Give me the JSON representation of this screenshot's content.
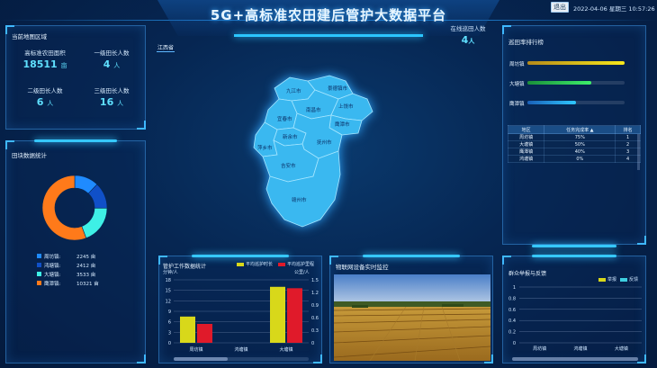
{
  "header": {
    "title": "5G+高标准农田建后管护大数据平台",
    "exit_label": "退出",
    "datetime": "2022-04-06 星期三 10:57:26"
  },
  "online": {
    "label": "在线巡田人数",
    "value": "4",
    "unit": "人"
  },
  "region_panel": {
    "title": "当前地图区域",
    "stats": [
      {
        "label": "高标准农田面积",
        "value": "18511",
        "unit": "亩"
      },
      {
        "label": "一级田长人数",
        "value": "4",
        "unit": "人"
      },
      {
        "label": "二级田长人数",
        "value": "6",
        "unit": "人"
      },
      {
        "label": "三级田长人数",
        "value": "16",
        "unit": "人"
      }
    ]
  },
  "plot_panel": {
    "title": "田块数据统计",
    "items": [
      {
        "name": "周坊镇:",
        "value": "2245 亩",
        "raw": 2245,
        "color": "#1f8bff"
      },
      {
        "name": "鸿塘镇:",
        "value": "2412 亩",
        "raw": 2412,
        "color": "#1050c8"
      },
      {
        "name": "大塘镇:",
        "value": "3533 亩",
        "raw": 3533,
        "color": "#3ef0e6"
      },
      {
        "name": "鹰潭镇:",
        "value": "10321 亩",
        "raw": 10321,
        "color": "#ff7a1a"
      }
    ]
  },
  "map": {
    "breadcrumb": "江西省",
    "cities": [
      "九江市",
      "景德镇市",
      "南昌市",
      "上饶市",
      "宜春市",
      "鹰潭市",
      "新余市",
      "萍乡市",
      "抚州市",
      "吉安市",
      "赣州市"
    ]
  },
  "patrol_rank": {
    "title": "巡田率排行榜",
    "bars": [
      {
        "name": "周坊镇",
        "pct": 1.0,
        "color_from": "#b58a1a",
        "color_to": "#f8e81a"
      },
      {
        "name": "大塘镇",
        "pct": 0.66,
        "color_from": "#1a8f3a",
        "color_to": "#3ef06a"
      },
      {
        "name": "鹰潭镇",
        "pct": 0.5,
        "color_from": "#1a5fb8",
        "color_to": "#2ec8ff"
      }
    ],
    "table": {
      "headers": [
        "地区",
        "任务完成率 ▲",
        "排名"
      ],
      "rows": [
        [
          "周坊镇",
          "75%",
          "1"
        ],
        [
          "大塘镇",
          "50%",
          "2"
        ],
        [
          "鹰潭镇",
          "40%",
          "3"
        ],
        [
          "鸿塘镇",
          "0%",
          "4"
        ]
      ]
    }
  },
  "care_chart": {
    "title": "管护工作数据统计",
    "legend": [
      "平均巡护时长",
      "平均巡护里程"
    ],
    "colors": [
      "#d8d81a",
      "#e01a2a"
    ],
    "left_unit": "分钟/人",
    "right_unit": "公里/人",
    "categories": [
      "周坊镇",
      "鸿塘镇",
      "大塘镇"
    ],
    "left_ticks": [
      "18",
      "15",
      "12",
      "9",
      "6",
      "3",
      "0"
    ],
    "right_ticks": [
      "1.5",
      "1.2",
      "0.9",
      "0.6",
      "0.3",
      "0"
    ],
    "chart_data": {
      "type": "bar",
      "categories": [
        "周坊镇",
        "鸿塘镇",
        "大塘镇"
      ],
      "series": [
        {
          "name": "平均巡护时长",
          "values": [
            7.5,
            0,
            16
          ],
          "axis": "left",
          "ylim": [
            0,
            18
          ]
        },
        {
          "name": "平均巡护里程",
          "values": [
            0.45,
            0,
            1.3
          ],
          "axis": "right",
          "ylim": [
            0,
            1.5
          ]
        }
      ]
    }
  },
  "iot": {
    "title": "物联网设备实时监控"
  },
  "feedback_chart": {
    "title": "群众举报与反馈",
    "legend": [
      "举报",
      "反馈"
    ],
    "colors": [
      "#d8d81a",
      "#3ecfe0"
    ],
    "ticks": [
      "1",
      "0.8",
      "0.6",
      "0.4",
      "0.2",
      "0"
    ],
    "categories": [
      "周坊镇",
      "鸿塘镇",
      "大塘镇"
    ],
    "chart_data": {
      "type": "bar",
      "categories": [
        "周坊镇",
        "鸿塘镇",
        "大塘镇"
      ],
      "series": [
        {
          "name": "举报",
          "values": [
            0,
            0,
            0
          ]
        },
        {
          "name": "反馈",
          "values": [
            0,
            0,
            0
          ]
        }
      ],
      "ylim": [
        0,
        1
      ]
    }
  }
}
